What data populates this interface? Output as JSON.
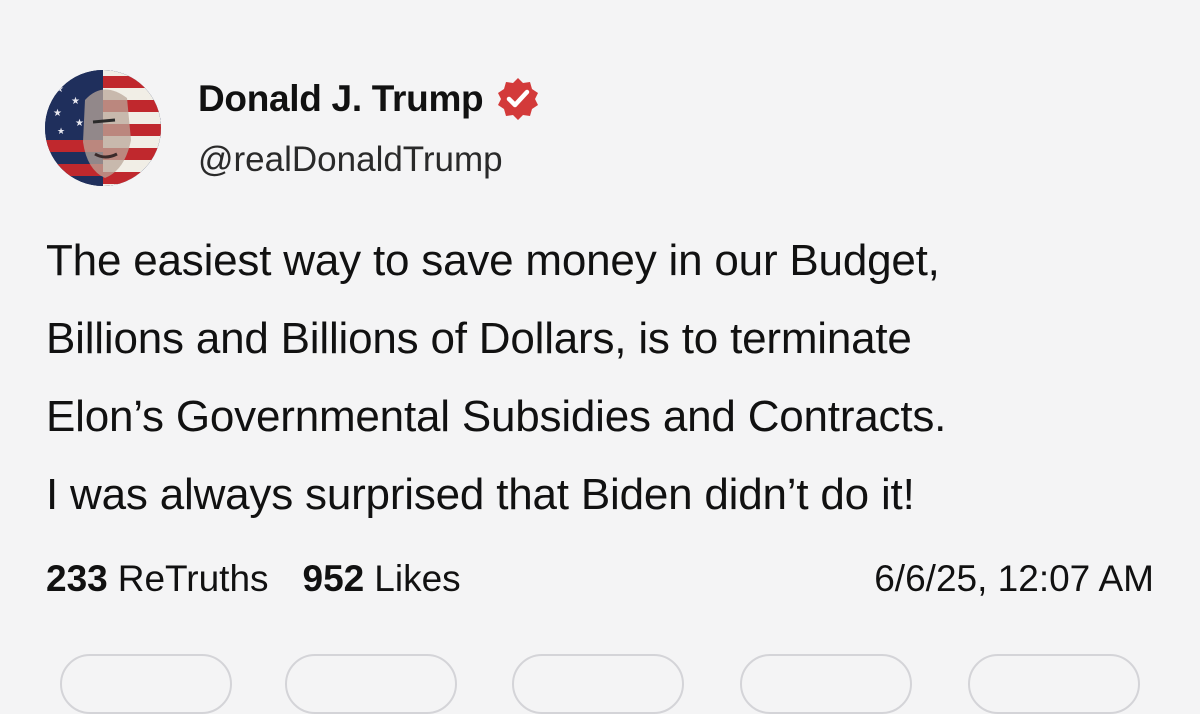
{
  "author": {
    "name": "Donald J. Trump",
    "handle": "@realDonaldTrump",
    "verified_icon": "verified-badge-icon",
    "verified_color": "#d33a3a"
  },
  "post": {
    "lines": [
      "The easiest way to save money in our Budget,",
      "Billions and Billions of Dollars, is to terminate",
      "Elon’s Governmental Subsidies and Contracts.",
      "I was always surprised that Biden didn’t do it!"
    ]
  },
  "stats": {
    "retruths_count": "233",
    "retruths_label": "ReTruths",
    "likes_count": "952",
    "likes_label": "Likes"
  },
  "timestamp": "6/6/25, 12:07 AM",
  "colors": {
    "background": "#f4f4f5",
    "text": "#111111",
    "accent": "#d33a3a"
  }
}
